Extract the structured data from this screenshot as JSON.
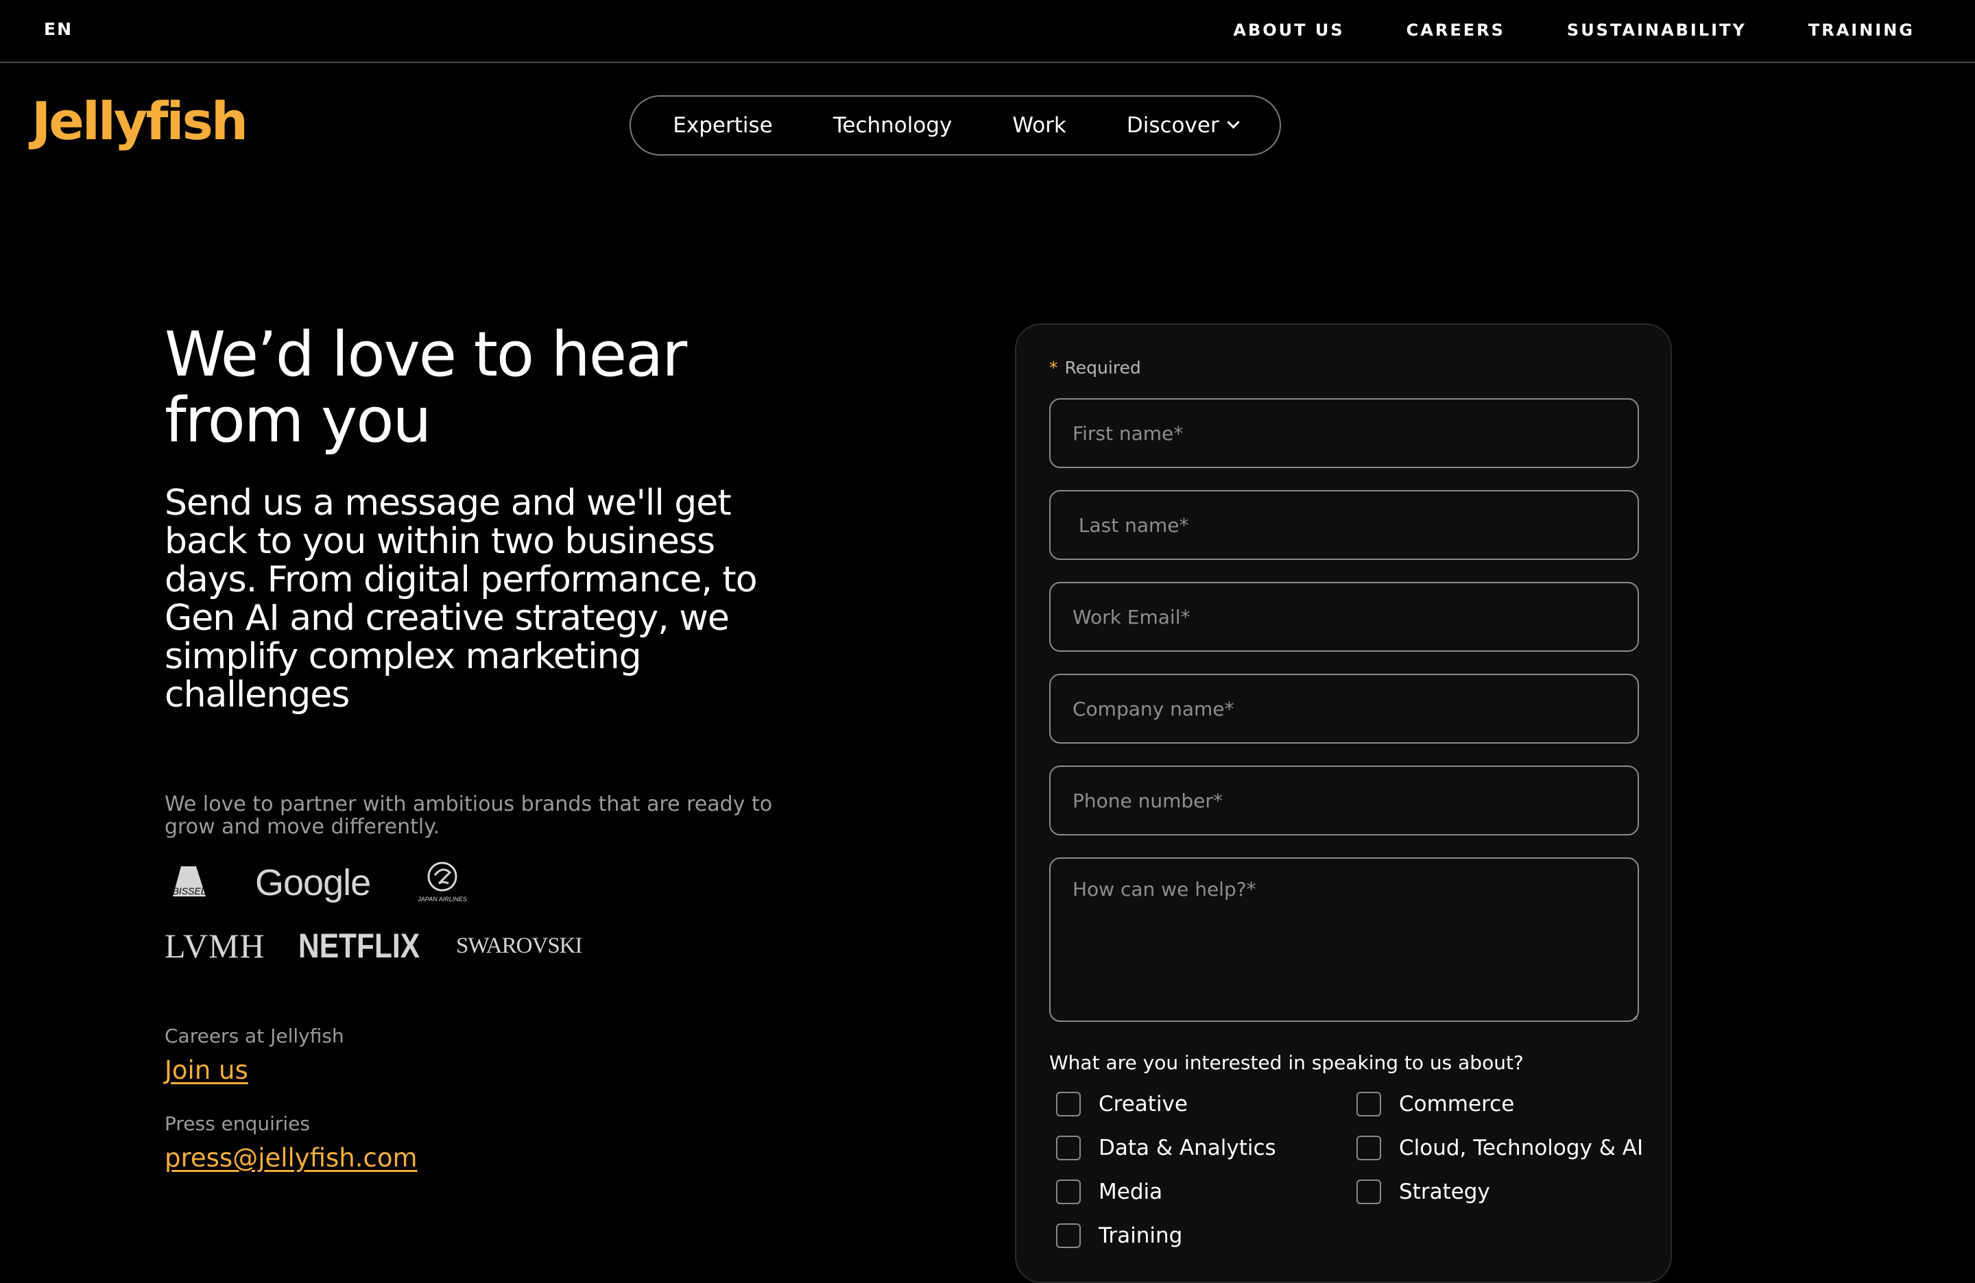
{
  "topbar": {
    "lang": "EN",
    "links": [
      "ABOUT US",
      "CAREERS",
      "SUSTAINABILITY",
      "TRAINING"
    ]
  },
  "brand": {
    "logo_text": "Jellyfish",
    "accent": "#f5ad3b"
  },
  "nav": {
    "items": [
      "Expertise",
      "Technology",
      "Work",
      "Discover"
    ]
  },
  "hero": {
    "headline": "We’d love to hear from you",
    "subhead": "Send us a message and we'll get back to you within two business days. From digital performance, to Gen AI and creative strategy, we simplify complex marketing challenges",
    "partner_text": "We love to partner with ambitious brands that are ready to grow and move differently."
  },
  "clients": {
    "row1": {
      "bissell": "BISSELL",
      "google": "Google",
      "jal": "JAPAN AIRLINES"
    },
    "row2": {
      "lvmh": "LVMH",
      "netflix": "NETFLIX",
      "swarovski": "SWAROVSKI"
    }
  },
  "contact": {
    "careers_label": "Careers at Jellyfish",
    "careers_link": "Join us",
    "press_label": "Press enquiries",
    "press_email": "press@jellyfish.com"
  },
  "form": {
    "required_note": "Required",
    "placeholders": {
      "first_name": "First name*",
      "last_name": " Last name*",
      "email": "Work Email*",
      "company": "Company name*",
      "phone": "Phone number*",
      "message": "How can we help?*"
    },
    "question": "What are you interested in speaking to us about?",
    "options": [
      "Creative",
      "Commerce",
      "Data & Analytics",
      "Cloud, Technology & AI",
      "Media",
      "Strategy",
      "Training"
    ]
  }
}
